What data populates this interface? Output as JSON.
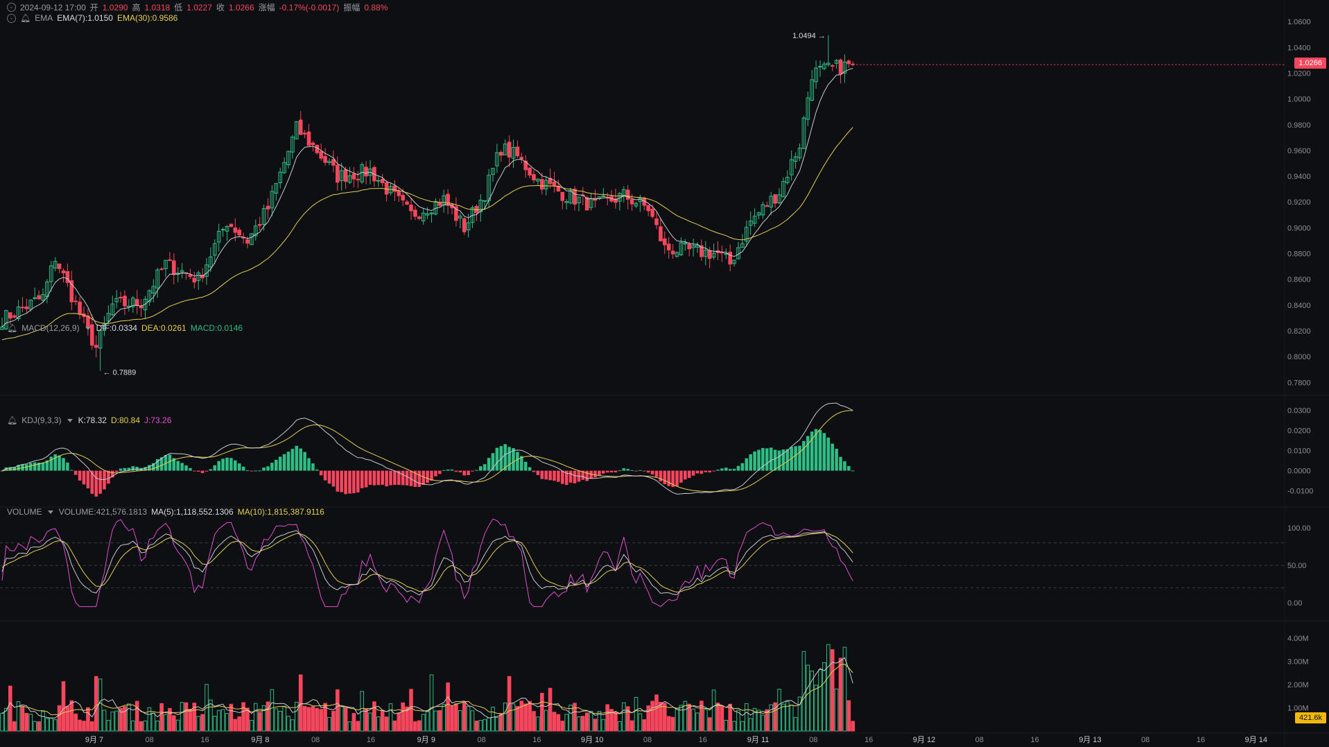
{
  "ohlc_header": {
    "datetime": "2024-09-12 17:00",
    "open_label": "开",
    "open": "1.0290",
    "high_label": "高",
    "high": "1.0318",
    "low_label": "低",
    "low": "1.0227",
    "close_label": "收",
    "close": "1.0266",
    "chg_label": "涨幅",
    "chg": "-0.17%(-0.0017)",
    "amp_label": "振幅",
    "amp": "0.88%"
  },
  "ema_header": {
    "name": "EMA",
    "ema7": "EMA(7):1.0150",
    "ema30": "EMA(30):0.9586"
  },
  "macd_header": {
    "name": "MACD(12,26,9)",
    "dif": "DIF:0.0334",
    "dea": "DEA:0.0261",
    "macd": "MACD:0.0146"
  },
  "kdj_header": {
    "name": "KDJ(9,3,3)",
    "k": "K:78.32",
    "d": "D:80.84",
    "j": "J:73.26"
  },
  "vol_header": {
    "name": "VOLUME",
    "vol": "VOLUME:421,576.1813",
    "ma5": "MA(5):1,118,552.1306",
    "ma10": "MA(10):1,815,387.9116"
  },
  "price_tag": "1.0266",
  "volume_tag": "421.6k",
  "colors": {
    "up": "#2ebd85",
    "down": "#f6465d",
    "ema7": "#c9cace",
    "ema30": "#e6d150",
    "dif": "#c9cace",
    "dea": "#e6d150",
    "j": "#e04fd0",
    "bg": "#0e0f13",
    "grid": "#1b1d22"
  },
  "chart_data": {
    "type": "candlestick",
    "price_axis": {
      "ticks": [
        1.06,
        1.04,
        1.02,
        1.0,
        0.98,
        0.96,
        0.94,
        0.92,
        0.9,
        0.88,
        0.86,
        0.84,
        0.82,
        0.8,
        0.78
      ],
      "tick_labels": [
        "1.0600",
        "1.0400",
        "1.0200",
        "1.0000",
        "0.9800",
        "0.9600",
        "0.9400",
        "0.9200",
        "0.9000",
        "0.8800",
        "0.8600",
        "0.8400",
        "0.8200",
        "0.8000",
        "0.7800"
      ],
      "range": [
        0.771,
        1.066
      ]
    },
    "macd_axis": {
      "ticks": [
        0.03,
        0.02,
        0.01,
        0.0,
        -0.01
      ],
      "tick_labels": [
        "0.0300",
        "0.0200",
        "0.0100",
        "0.0000",
        "-0.0100"
      ],
      "range": [
        -0.016,
        0.034
      ]
    },
    "kdj_axis": {
      "ticks": [
        100,
        50,
        0
      ],
      "tick_labels": [
        "100.00",
        "50.00",
        "0.00"
      ],
      "range": [
        -10,
        115
      ]
    },
    "volume_axis": {
      "ticks": [
        4000000,
        3000000,
        2000000,
        1000000
      ],
      "tick_labels": [
        "4.00M",
        "3.00M",
        "2.00M",
        "1.00M"
      ],
      "range": [
        0,
        4600000
      ]
    },
    "time_labels": [
      "9月 7",
      "08",
      "16",
      "9月 8",
      "08",
      "16",
      "9月 9",
      "08",
      "16",
      "9月 10",
      "08",
      "16",
      "9月 11",
      "08",
      "16",
      "9月 12",
      "08",
      "16",
      "9月 13",
      "08",
      "16",
      "9月 14"
    ],
    "annotations": {
      "high": "1.0494",
      "low": "0.7889"
    },
    "candles_desc": "hourly OHLC, 2024-09-06 ~16:00 to 2024-09-12 17:00, approximated from chart",
    "key_points": [
      {
        "t": 0,
        "c": 0.829
      },
      {
        "t": 10,
        "c": 0.846
      },
      {
        "t": 13,
        "c": 0.877
      },
      {
        "t": 20,
        "c": 0.826
      },
      {
        "t": 23,
        "c": 0.807
      },
      {
        "t": 27,
        "c": 0.84
      },
      {
        "t": 34,
        "c": 0.842
      },
      {
        "t": 40,
        "c": 0.872
      },
      {
        "t": 48,
        "c": 0.86
      },
      {
        "t": 55,
        "c": 0.905
      },
      {
        "t": 60,
        "c": 0.89
      },
      {
        "t": 65,
        "c": 0.915
      },
      {
        "t": 72,
        "c": 0.977
      },
      {
        "t": 77,
        "c": 0.96
      },
      {
        "t": 82,
        "c": 0.94
      },
      {
        "t": 90,
        "c": 0.944
      },
      {
        "t": 95,
        "c": 0.927
      },
      {
        "t": 100,
        "c": 0.91
      },
      {
        "t": 108,
        "c": 0.922
      },
      {
        "t": 113,
        "c": 0.9
      },
      {
        "t": 118,
        "c": 0.927
      },
      {
        "t": 122,
        "c": 0.962
      },
      {
        "t": 126,
        "c": 0.955
      },
      {
        "t": 131,
        "c": 0.937
      },
      {
        "t": 138,
        "c": 0.925
      },
      {
        "t": 145,
        "c": 0.917
      },
      {
        "t": 152,
        "c": 0.925
      },
      {
        "t": 158,
        "c": 0.915
      },
      {
        "t": 162,
        "c": 0.884
      },
      {
        "t": 168,
        "c": 0.882
      },
      {
        "t": 175,
        "c": 0.88
      },
      {
        "t": 178,
        "c": 0.872
      },
      {
        "t": 183,
        "c": 0.905
      },
      {
        "t": 190,
        "c": 0.928
      },
      {
        "t": 195,
        "c": 0.965
      },
      {
        "t": 198,
        "c": 1.02
      },
      {
        "t": 205,
        "c": 1.025
      },
      {
        "t": 208,
        "c": 1.0266
      }
    ]
  }
}
